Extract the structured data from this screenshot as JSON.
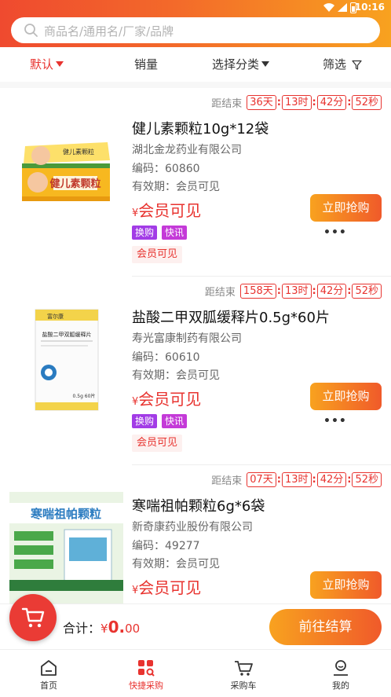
{
  "status": {
    "time": "10:16",
    "battery": "2"
  },
  "search": {
    "placeholder": "商品名/通用名/厂家/品牌"
  },
  "tabs": [
    {
      "label": "默认"
    },
    {
      "label": "销量"
    },
    {
      "label": "选择分类"
    },
    {
      "label": "筛选"
    }
  ],
  "products": [
    {
      "countdown_label": "距结束",
      "days": "36天",
      "hours": "13时",
      "minutes": "42分",
      "seconds": "52秒",
      "name": "健儿素颗粒10g*12袋",
      "maker": "湖北金龙药业有限公司",
      "code": "编码：60860",
      "expiry": "有效期：会员可见",
      "currency": "¥",
      "price": "会员可见",
      "buy_label": "立即抢购",
      "tags": [
        "换购",
        "快讯"
      ],
      "visibility": "会员可见",
      "box_title": "健儿素颗粒",
      "box_small": "健儿素颗粒"
    },
    {
      "countdown_label": "距结束",
      "days": "158天",
      "hours": "13时",
      "minutes": "42分",
      "seconds": "52秒",
      "name": "盐酸二甲双胍缓释片0.5g*60片",
      "maker": "寿光富康制药有限公司",
      "code": "编码：60610",
      "expiry": "有效期：会员可见",
      "currency": "¥",
      "price": "会员可见",
      "buy_label": "立即抢购",
      "tags": [
        "换购",
        "快讯"
      ],
      "visibility": "会员可见",
      "box_title": "盐酸二甲双胍缓释片",
      "box_brand": "富尔康",
      "box_spec": "0.5g  60片"
    },
    {
      "countdown_label": "距结束",
      "days": "07天",
      "hours": "13时",
      "minutes": "42分",
      "seconds": "52秒",
      "name": "寒喘祖帕颗粒6g*6袋",
      "maker": "新奇康药业股份有限公司",
      "code": "编码：49277",
      "expiry": "有效期：会员可见",
      "currency": "¥",
      "price": "会员可见",
      "buy_label": "立即抢购",
      "box_title": "寒喘祖帕颗粒"
    }
  ],
  "checkout": {
    "total_label": "合计：",
    "currency": "¥",
    "amount": "0.",
    "decimals": "00",
    "button": "前往结算"
  },
  "tabbar": [
    {
      "label": "首页"
    },
    {
      "label": "快捷采购"
    },
    {
      "label": "采购车"
    },
    {
      "label": "我的"
    }
  ],
  "colors": {
    "accent": "#e8332f",
    "gradient_start": "#f8a21f",
    "gradient_end": "#f05a2a",
    "tag_purple": "#a23ce6"
  }
}
